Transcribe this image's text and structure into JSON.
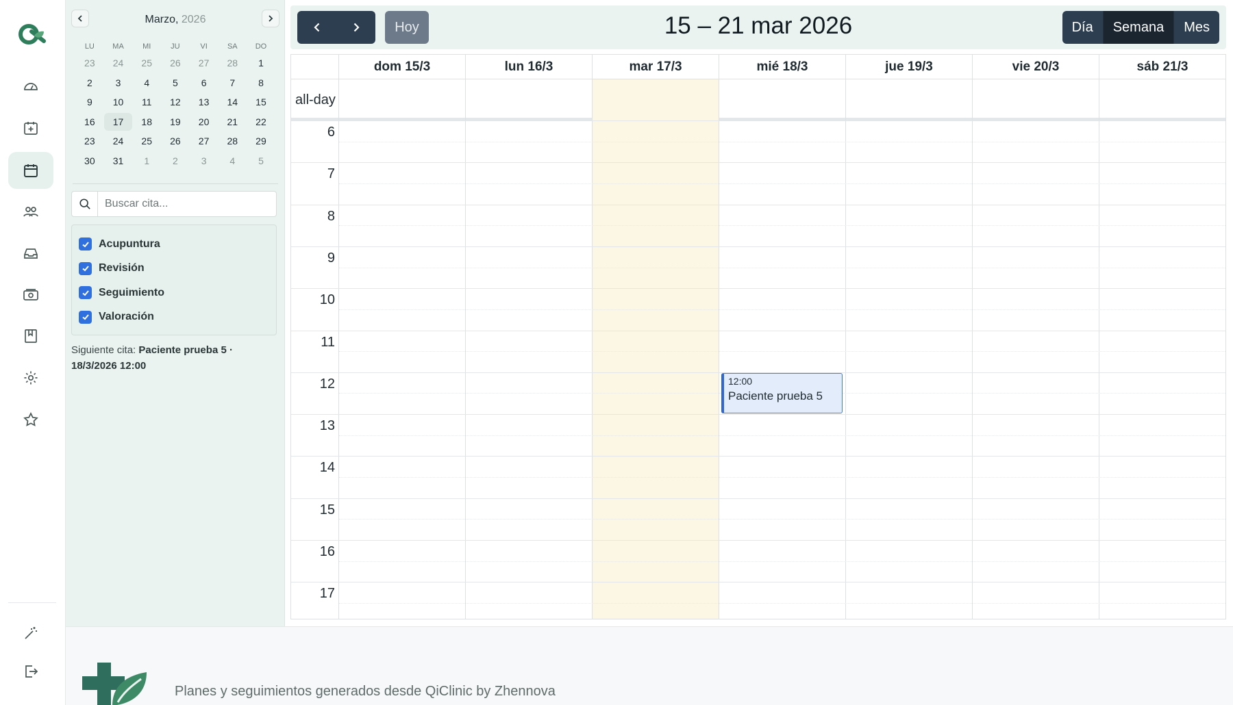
{
  "sidebar": {
    "items": [
      {
        "name": "dashboard-icon"
      },
      {
        "name": "calendar-add-icon"
      },
      {
        "name": "calendar-icon",
        "active": true
      },
      {
        "name": "users-icon"
      },
      {
        "name": "inbox-icon"
      },
      {
        "name": "money-icon"
      },
      {
        "name": "book-icon"
      },
      {
        "name": "gear-icon"
      },
      {
        "name": "star-icon"
      }
    ],
    "bottom": [
      {
        "name": "magic-wand-icon"
      },
      {
        "name": "logout-icon"
      }
    ]
  },
  "mini_calendar": {
    "month": "Marzo,",
    "year": "2026",
    "weekdays": [
      "LU",
      "MA",
      "MI",
      "JU",
      "VI",
      "SA",
      "DO"
    ],
    "weeks": [
      [
        {
          "d": "23",
          "dim": true
        },
        {
          "d": "24",
          "dim": true
        },
        {
          "d": "25",
          "dim": true
        },
        {
          "d": "26",
          "dim": true
        },
        {
          "d": "27",
          "dim": true
        },
        {
          "d": "28",
          "dim": true
        },
        {
          "d": "1"
        }
      ],
      [
        {
          "d": "2"
        },
        {
          "d": "3"
        },
        {
          "d": "4"
        },
        {
          "d": "5"
        },
        {
          "d": "6"
        },
        {
          "d": "7"
        },
        {
          "d": "8"
        }
      ],
      [
        {
          "d": "9"
        },
        {
          "d": "10"
        },
        {
          "d": "11"
        },
        {
          "d": "12"
        },
        {
          "d": "13"
        },
        {
          "d": "14"
        },
        {
          "d": "15"
        }
      ],
      [
        {
          "d": "16"
        },
        {
          "d": "17",
          "today": true
        },
        {
          "d": "18"
        },
        {
          "d": "19"
        },
        {
          "d": "20"
        },
        {
          "d": "21"
        },
        {
          "d": "22"
        }
      ],
      [
        {
          "d": "23"
        },
        {
          "d": "24"
        },
        {
          "d": "25"
        },
        {
          "d": "26"
        },
        {
          "d": "27"
        },
        {
          "d": "28"
        },
        {
          "d": "29"
        }
      ],
      [
        {
          "d": "30"
        },
        {
          "d": "31"
        },
        {
          "d": "1",
          "dim": true
        },
        {
          "d": "2",
          "dim": true
        },
        {
          "d": "3",
          "dim": true
        },
        {
          "d": "4",
          "dim": true
        },
        {
          "d": "5",
          "dim": true
        }
      ]
    ]
  },
  "search": {
    "placeholder": "Buscar cita..."
  },
  "filters": [
    {
      "label": "Acupuntura",
      "checked": true
    },
    {
      "label": "Revisión",
      "checked": true
    },
    {
      "label": "Seguimiento",
      "checked": true
    },
    {
      "label": "Valoración",
      "checked": true
    }
  ],
  "next_appointment": {
    "prefix": "Siguiente cita:",
    "value": "Paciente prueba 5 · 18/3/2026 12:00"
  },
  "toolbar": {
    "today_label": "Hoy",
    "title": "15 – 21 mar 2026",
    "views": [
      {
        "label": "Día",
        "active": false
      },
      {
        "label": "Semana",
        "active": true
      },
      {
        "label": "Mes",
        "active": false
      }
    ]
  },
  "week": {
    "days": [
      "dom 15/3",
      "lun 16/3",
      "mar 17/3",
      "mié 18/3",
      "jue 19/3",
      "vie 20/3",
      "sáb 21/3"
    ],
    "today_index": 2,
    "allday_label": "all-day",
    "hours": [
      "6",
      "7",
      "8",
      "9",
      "10",
      "11",
      "12",
      "13",
      "14",
      "15",
      "16",
      "17"
    ]
  },
  "events": [
    {
      "day_index": 3,
      "time": "12:00",
      "title": "Paciente prueba 5"
    }
  ],
  "footer": {
    "text": "Planes y seguimientos generados desde QiClinic by Zhennova"
  },
  "colors": {
    "brand": "#2e7d5b",
    "panel": "#eaf3f0",
    "today": "#fcf7e4",
    "event": "#2f66cf",
    "dark_button": "#2c3e50"
  }
}
